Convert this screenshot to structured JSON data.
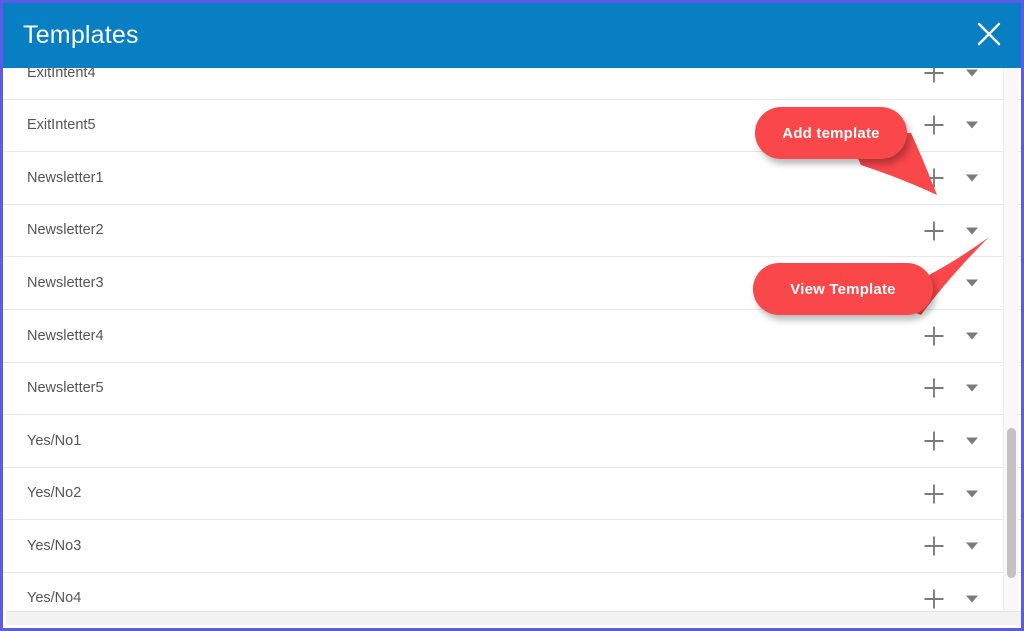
{
  "window": {
    "border_color": "#5b5be8",
    "background": "#ffffff"
  },
  "header": {
    "title": "Templates",
    "background_color": "#077fc2",
    "text_color": "#ffffff",
    "close_label": "✕"
  },
  "list": {
    "add_icon_name": "plus-icon",
    "caret_icon_name": "chevron-down-icon",
    "rows": [
      {
        "name": "ExitIntent4"
      },
      {
        "name": "ExitIntent5"
      },
      {
        "name": "Newsletter1"
      },
      {
        "name": "Newsletter2"
      },
      {
        "name": "Newsletter3"
      },
      {
        "name": "Newsletter4"
      },
      {
        "name": "Newsletter5"
      },
      {
        "name": "Yes/No1"
      },
      {
        "name": "Yes/No2"
      },
      {
        "name": "Yes/No3"
      },
      {
        "name": "Yes/No4"
      }
    ]
  },
  "callouts": [
    {
      "id": "add-template",
      "text": "Add template",
      "color": "#f9474a",
      "text_color": "#ffffff"
    },
    {
      "id": "view-template",
      "text": "View Template",
      "color": "#f9474a",
      "text_color": "#ffffff"
    }
  ],
  "scrollbars": {
    "vertical_thumb_color": "#c2c2c2",
    "track_color": "#f8f8f8"
  }
}
